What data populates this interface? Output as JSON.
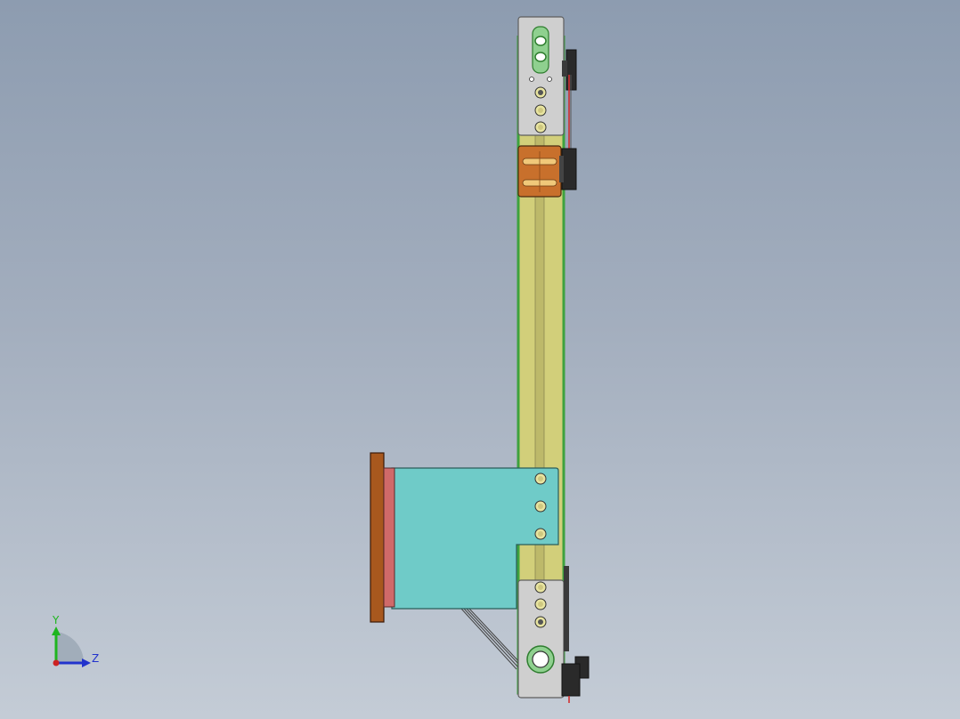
{
  "window": {
    "background_top": "#8d9cb0",
    "background_bottom": "#c4ccd6"
  },
  "model": {
    "colors": {
      "rail": "#d2cf7a",
      "rail_edge": "#9a9550",
      "green_edge": "#3ea23e",
      "plate": "#cfcfcf",
      "plate_edge": "#6e6e6e",
      "carriage": "#c8702c",
      "carriage_slot": "#f0c87a",
      "bracket": "#6fcbc8",
      "flange": "#a8581e",
      "pad": "#d06a6a",
      "sensor": "#2a2a2a",
      "wire": "#d03030",
      "hole": "#e8e4a0"
    }
  },
  "triad": {
    "y_label": "Y",
    "z_label": "Z",
    "y_color": "#1fb51f",
    "z_color": "#2233cc",
    "x_color": "#cc2222"
  }
}
